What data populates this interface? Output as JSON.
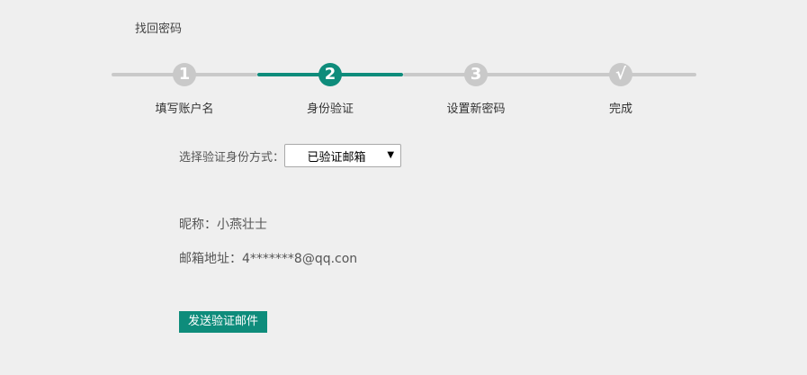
{
  "page": {
    "title": "找回密码"
  },
  "stepper": {
    "current_step": 2,
    "steps": [
      {
        "marker": "1",
        "label": "填写账户名"
      },
      {
        "marker": "2",
        "label": "身份验证"
      },
      {
        "marker": "3",
        "label": "设置新密码"
      },
      {
        "marker": "√",
        "label": "完成"
      }
    ]
  },
  "form": {
    "method_label": "选择验证身份方式：",
    "method_selected": "已验证邮箱",
    "nickname": "昵称：小燕壮士",
    "email": "邮箱地址：4*******8@qq.con",
    "send_button": "发送验证邮件"
  },
  "colors": {
    "accent": "#0e8c7b",
    "inactive": "#c9c9c9",
    "background": "#efefef"
  },
  "icons": {
    "select_arrow": "caret-down-icon"
  }
}
